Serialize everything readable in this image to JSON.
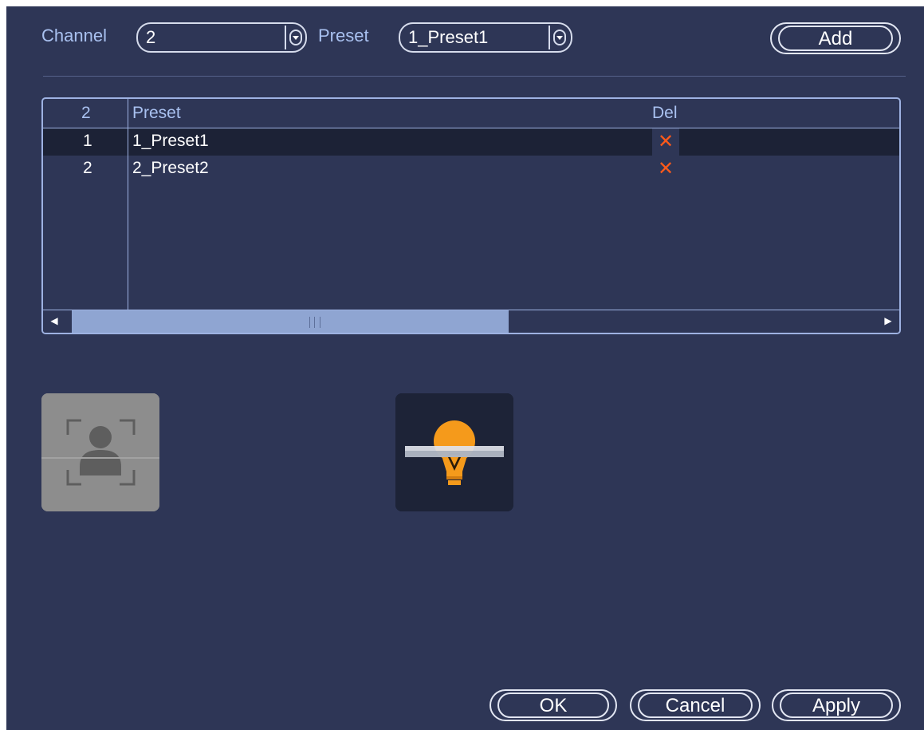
{
  "channel": {
    "label": "Channel",
    "value": "2"
  },
  "preset": {
    "label": "Preset",
    "value": "1_Preset1"
  },
  "add_label": "Add",
  "table": {
    "headers": {
      "num": "2",
      "preset": "Preset",
      "del": "Del"
    },
    "rows": [
      {
        "num": "1",
        "preset": "1_Preset1",
        "selected": true
      },
      {
        "num": "2",
        "preset": "2_Preset2",
        "selected": false
      }
    ]
  },
  "icons": {
    "face": "face-detect-icon",
    "light": "light-bulb-icon",
    "delete": "delete-x-icon"
  },
  "colors": {
    "background": "#2e3656",
    "accent_label": "#a9c1f0",
    "delete": "#ff5a1a",
    "bulb": "#f59a1b"
  },
  "buttons": {
    "ok": "OK",
    "cancel": "Cancel",
    "apply": "Apply"
  }
}
